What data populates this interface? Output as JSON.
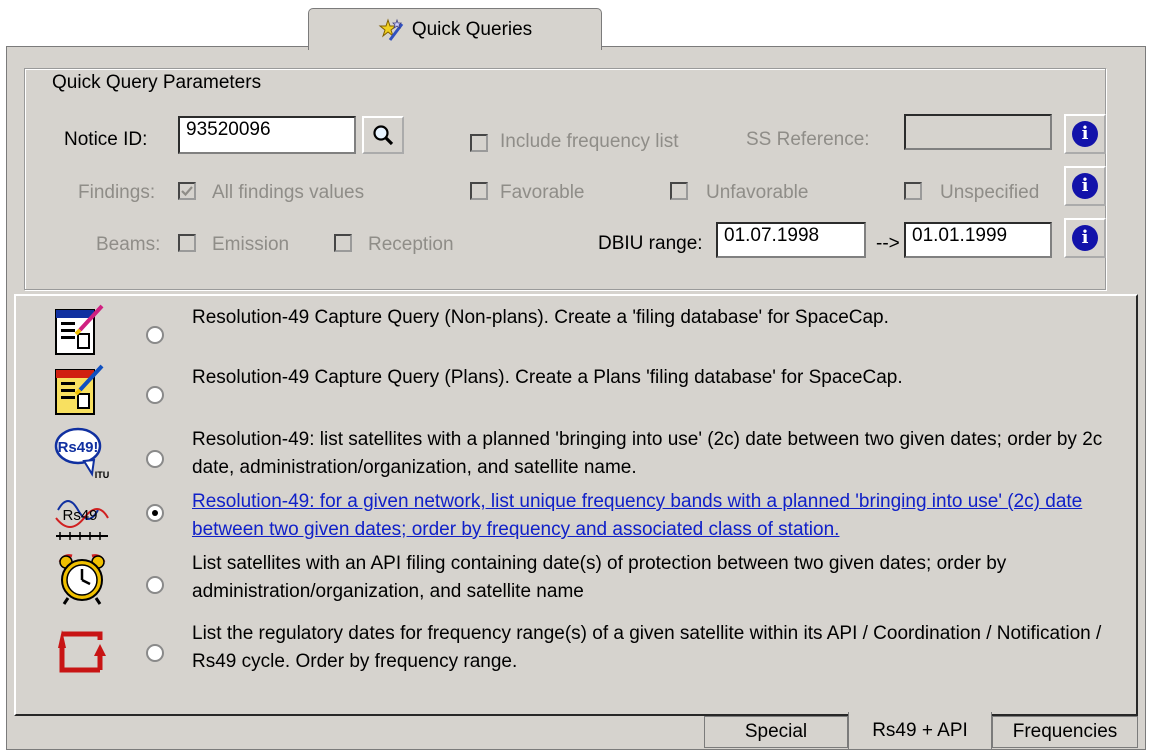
{
  "tab": {
    "label": "Quick Queries",
    "icon": "wand-stars-icon"
  },
  "params": {
    "legend": "Quick Query Parameters",
    "notice_label": "Notice ID:",
    "notice_value": "93520096",
    "include_freq_label": "Include frequency list",
    "ss_ref_label": "SS Reference:",
    "ss_ref_value": "",
    "findings_label": "Findings:",
    "all_findings_label": "All findings values",
    "favorable_label": "Favorable",
    "unfavorable_label": "Unfavorable",
    "unspecified_label": "Unspecified",
    "beams_label": "Beams:",
    "emission_label": "Emission",
    "reception_label": "Reception",
    "dbiu_label": "DBIU range:",
    "dbiu_from": "01.07.1998",
    "dbiu_arrow": "-->",
    "dbiu_to": "01.01.1999",
    "info_glyph": "i"
  },
  "queries": [
    {
      "icon": "form-edit-icon",
      "text": "Resolution-49 Capture Query (Non-plans). Create a 'filing database' for SpaceCap.",
      "selected": false
    },
    {
      "icon": "form-plans-edit-icon",
      "text": "Resolution-49 Capture Query (Plans). Create a Plans 'filing database' for SpaceCap.",
      "selected": false
    },
    {
      "icon": "rs49-itu-icon",
      "icon_text": "Rs49!",
      "icon_sub": "ITU",
      "text": "Resolution-49: list satellites with a planned 'bringing into use' (2c) date between two given dates; order by 2c date, administration/organization, and satellite name.",
      "selected": false
    },
    {
      "icon": "rs49-frequency-icon",
      "icon_text": "Rs49",
      "text": "Resolution-49: for a given network, list unique frequency bands with a planned 'bringing into use' (2c) date between two given dates; order by frequency and associated class of station.",
      "selected": true
    },
    {
      "icon": "alarm-clock-icon",
      "text": "List satellites with an API filing containing date(s) of protection between two given dates; order by administration/organization, and satellite name",
      "selected": false
    },
    {
      "icon": "cycle-arrows-icon",
      "text": "List the regulatory dates for frequency range(s) of a given satellite within its API / Coordination / Notification / Rs49 cycle. Order by frequency range.",
      "selected": false
    }
  ],
  "bottom_tabs": [
    "Special",
    "Rs49 + API",
    "Frequencies"
  ]
}
